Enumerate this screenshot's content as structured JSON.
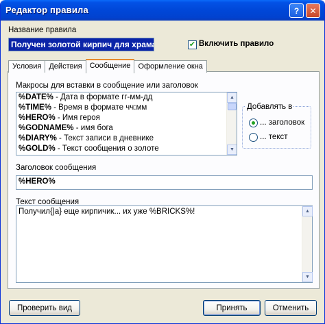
{
  "window": {
    "title": "Редактор правила"
  },
  "rule": {
    "name_label": "Название правила",
    "name_value": "Получен золотой кирпич для храма",
    "enable_label": "Включить правило"
  },
  "tabs": [
    {
      "label": "Условия"
    },
    {
      "label": "Действия"
    },
    {
      "label": "Сообщение"
    },
    {
      "label": "Оформление окна"
    }
  ],
  "macros": {
    "label": "Макросы для вставки в сообщение или заголовок",
    "items": [
      {
        "code": "%DATE%",
        "desc": " - Дата в формате гг-мм-дд"
      },
      {
        "code": "%TIME%",
        "desc": " - Время в формате чч:мм"
      },
      {
        "code": "%HERO%",
        "desc": " - Имя героя"
      },
      {
        "code": "%GODNAME%",
        "desc": " - имя бога"
      },
      {
        "code": "%DIARY%",
        "desc": " - Текст записи в дневнике"
      },
      {
        "code": "%GOLD%",
        "desc": " - Текст сообщения о золоте"
      }
    ]
  },
  "append": {
    "title": "Добавлять в",
    "options": [
      {
        "label": "... заголовок",
        "selected": true
      },
      {
        "label": "... текст",
        "selected": false
      }
    ]
  },
  "message": {
    "header_label": "Заголовок сообщения",
    "header_value": "%HERO%",
    "text_label": "Текст сообщения",
    "text_value": "Получил{|а} еще кирпичик... их уже %BRICKS%!"
  },
  "buttons": {
    "preview": "Проверить вид",
    "accept": "Принять",
    "cancel": "Отменить"
  },
  "controls": {
    "help": "?",
    "close": "✕",
    "check": "✔"
  }
}
